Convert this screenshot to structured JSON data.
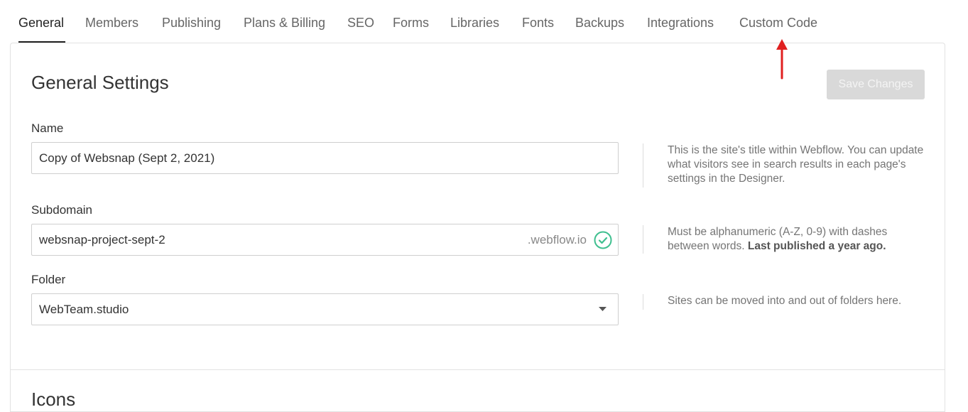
{
  "tabs": [
    {
      "label": "General",
      "active": true
    },
    {
      "label": "Members",
      "active": false
    },
    {
      "label": "Publishing",
      "active": false
    },
    {
      "label": "Plans & Billing",
      "active": false
    },
    {
      "label": "SEO",
      "active": false
    },
    {
      "label": "Forms",
      "active": false
    },
    {
      "label": "Libraries",
      "active": false
    },
    {
      "label": "Fonts",
      "active": false
    },
    {
      "label": "Backups",
      "active": false
    },
    {
      "label": "Integrations",
      "active": false
    },
    {
      "label": "Custom Code",
      "active": false
    }
  ],
  "annotation": {
    "arrow_color": "#e02020",
    "arrow_icon": "arrow-up-icon"
  },
  "general": {
    "title": "General Settings",
    "save_label": "Save Changes",
    "name": {
      "label": "Name",
      "value": "Copy of Websnap (Sept 2, 2021)",
      "help": "This is the site's title within Webflow. You can update what visitors see in search results in each page's settings in the Designer."
    },
    "subdomain": {
      "label": "Subdomain",
      "value": "websnap-project-sept-2",
      "suffix": ".webflow.io",
      "status_icon": "check-circle-icon",
      "status_color": "#3fbf8f",
      "help_prefix": "Must be alphanumeric (A-Z, 0-9) with dashes between words.",
      "help_bold": "Last published a year ago."
    },
    "folder": {
      "label": "Folder",
      "value": "WebTeam.studio",
      "help": "Sites can be moved into and out of folders here."
    }
  },
  "icons": {
    "title": "Icons"
  }
}
